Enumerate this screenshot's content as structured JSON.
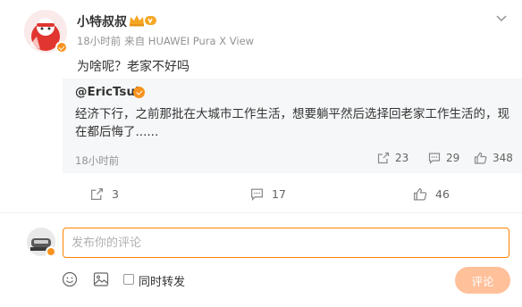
{
  "post": {
    "author": "小特叔叔",
    "time": "18小时前",
    "source": "来自 HUAWEI Pura X View",
    "text": "为啥呢？老家不好吗",
    "repost": {
      "handle": "@EricTsui",
      "text": "经济下行，之前那批在大城市工作生活，想要躺平然后选择回老家工作生活的，现在都后悔了......",
      "time": "18小时前",
      "reposts": "23",
      "comments": "29",
      "likes": "348"
    },
    "reposts": "3",
    "comments": "17",
    "likes": "46"
  },
  "comment_box": {
    "placeholder": "发布你的评论",
    "also_repost_label": "同时转发",
    "submit_label": "评论"
  },
  "icons": {
    "chevron": "chevron-down-icon",
    "repost": "repost-icon",
    "comment": "comment-icon",
    "like": "like-icon",
    "emoji": "emoji-icon",
    "image": "image-icon",
    "crown": "member-crown-icon"
  },
  "colors": {
    "accent": "#ff8200",
    "verified": "#f7931e",
    "repost_bg": "#f6f7f8",
    "muted_text": "#939393",
    "submit_bg": "#ffc09a"
  }
}
